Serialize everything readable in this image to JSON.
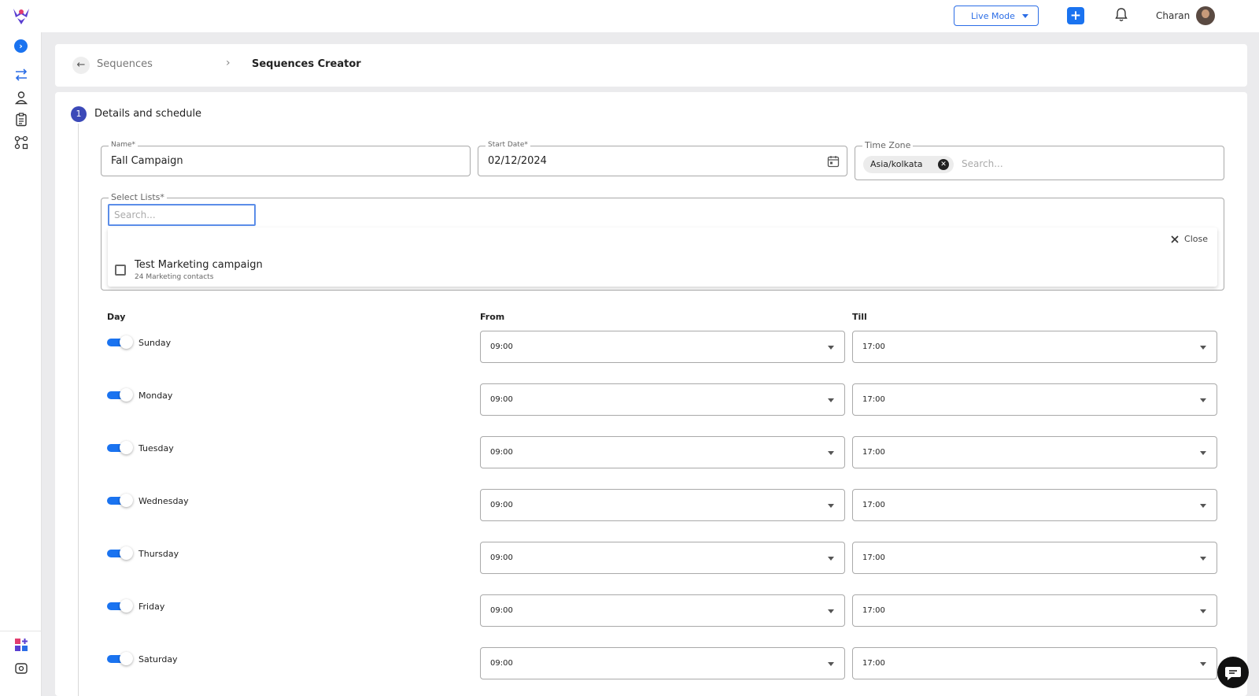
{
  "header": {
    "mode_label": "Live Mode",
    "user_name": "Charan"
  },
  "breadcrumb": {
    "parent": "Sequences",
    "current": "Sequences Creator"
  },
  "step": {
    "number": "1",
    "title": "Details and schedule"
  },
  "form": {
    "name_label": "Name*",
    "name_value": "Fall Campaign",
    "start_date_label": "Start Date*",
    "start_date_value": "02/12/2024",
    "timezone_label": "Time Zone",
    "timezone_chip": "Asia/kolkata",
    "timezone_placeholder": "Search...",
    "lists_label": "Select Lists*",
    "lists_placeholder": "Search...",
    "close_label": "Close",
    "list_options": [
      {
        "name": "Test Marketing campaign",
        "sub": "24 Marketing contacts",
        "checked": false
      }
    ]
  },
  "schedule": {
    "headers": {
      "day": "Day",
      "from": "From",
      "till": "Till"
    },
    "rows": [
      {
        "day": "Sunday",
        "enabled": true,
        "from": "09:00",
        "till": "17:00"
      },
      {
        "day": "Monday",
        "enabled": true,
        "from": "09:00",
        "till": "17:00"
      },
      {
        "day": "Tuesday",
        "enabled": true,
        "from": "09:00",
        "till": "17:00"
      },
      {
        "day": "Wednesday",
        "enabled": true,
        "from": "09:00",
        "till": "17:00"
      },
      {
        "day": "Thursday",
        "enabled": true,
        "from": "09:00",
        "till": "17:00"
      },
      {
        "day": "Friday",
        "enabled": true,
        "from": "09:00",
        "till": "17:00"
      },
      {
        "day": "Saturday",
        "enabled": true,
        "from": "09:00",
        "till": "17:00"
      }
    ]
  },
  "colors": {
    "accent": "#1a73f0",
    "step": "#3b49b8",
    "brand": "#5a3fd1"
  }
}
